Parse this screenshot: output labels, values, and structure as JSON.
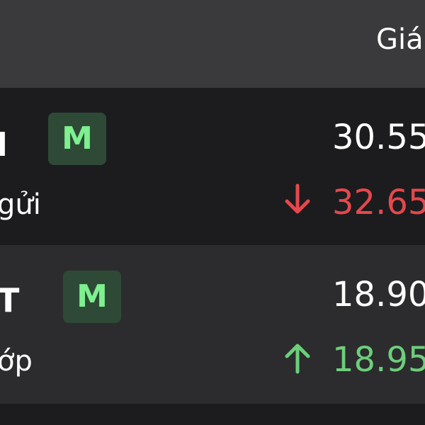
{
  "header": {
    "price_label": "Giá"
  },
  "rows": [
    {
      "symbol": "I",
      "name": "gửi",
      "badge": "M",
      "price": "30.55",
      "ref_price": "32.65",
      "direction": "down",
      "direction_color": "#e5484d"
    },
    {
      "symbol": "T",
      "name": "ớp",
      "badge": "M",
      "price": "18.90",
      "ref_price": "18.95",
      "direction": "up",
      "direction_color": "#6ccf7a"
    }
  ],
  "colors": {
    "header_bg": "#3a3a3c",
    "row_bg_dark": "#1c1c1e",
    "row_bg_alt": "#2c2c2e",
    "badge_bg": "#2e4a37",
    "badge_text": "#7ef08f",
    "down": "#e5484d",
    "up": "#6ccf7a"
  }
}
